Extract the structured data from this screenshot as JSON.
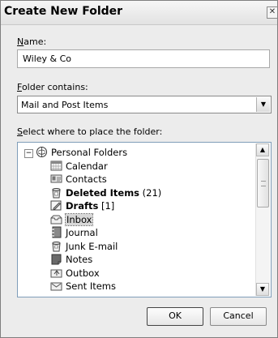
{
  "dialog": {
    "title": "Create New Folder",
    "close_icon": "close-icon"
  },
  "name_field": {
    "label_prefix": "",
    "label_accel": "N",
    "label_rest": "ame:",
    "value": "Wiley & Co"
  },
  "contains_field": {
    "label_accel": "F",
    "label_rest": "older contains:",
    "value": "Mail and Post Items"
  },
  "location_field": {
    "label_accel": "S",
    "label_rest": "elect where to place the folder:"
  },
  "tree": {
    "root": {
      "label": "Personal Folders",
      "icon": "personal-folders-icon",
      "expander": "−"
    },
    "items": [
      {
        "label": "Calendar",
        "count": "",
        "bold": false,
        "icon": "calendar-icon"
      },
      {
        "label": "Contacts",
        "count": "",
        "bold": false,
        "icon": "contacts-icon"
      },
      {
        "label": "Deleted Items",
        "count": "(21)",
        "bold": true,
        "icon": "deleted-items-icon"
      },
      {
        "label": "Drafts",
        "count": "[1]",
        "bold": true,
        "icon": "drafts-icon"
      },
      {
        "label": "Inbox",
        "count": "",
        "bold": false,
        "icon": "inbox-icon",
        "selected": true
      },
      {
        "label": "Journal",
        "count": "",
        "bold": false,
        "icon": "journal-icon"
      },
      {
        "label": "Junk E-mail",
        "count": "",
        "bold": false,
        "icon": "junk-email-icon"
      },
      {
        "label": "Notes",
        "count": "",
        "bold": false,
        "icon": "notes-icon"
      },
      {
        "label": "Outbox",
        "count": "",
        "bold": false,
        "icon": "outbox-icon"
      },
      {
        "label": "Sent Items",
        "count": "",
        "bold": false,
        "icon": "sent-items-icon"
      }
    ]
  },
  "buttons": {
    "ok": "OK",
    "cancel": "Cancel"
  }
}
